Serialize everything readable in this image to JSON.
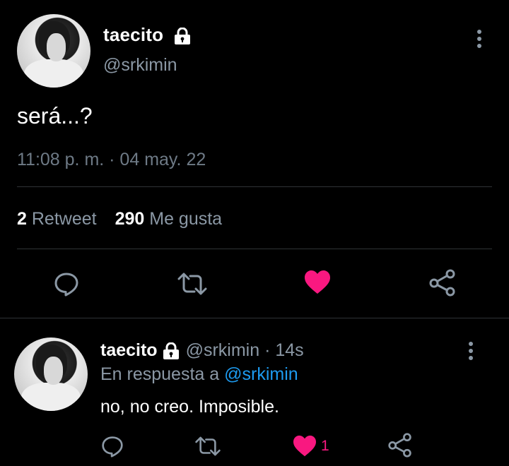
{
  "tweet": {
    "display_name": "taecito",
    "handle": "@srkimin",
    "text": "será...?",
    "timestamp": "11:08 p. m. · 04 may. 22",
    "retweets_count": "2",
    "retweets_label": "Retweet",
    "likes_count": "290",
    "likes_label": "Me gusta",
    "liked": true
  },
  "reply": {
    "display_name": "taecito",
    "handle_time": "@srkimin · 14s",
    "replying_label": "En respuesta a",
    "replying_mention": "@srkimin",
    "text": "no, no creo. Imposible.",
    "likes_count": "1",
    "liked": true
  },
  "colors": {
    "background": "#000000",
    "secondary_text": "#8b98a5",
    "like_pink": "#f91880",
    "mention_blue": "#1d9bf0",
    "divider": "#2f3336"
  },
  "icons": [
    "lock-icon",
    "more-options-icon",
    "reply-icon",
    "retweet-icon",
    "heart-icon",
    "share-icon"
  ]
}
